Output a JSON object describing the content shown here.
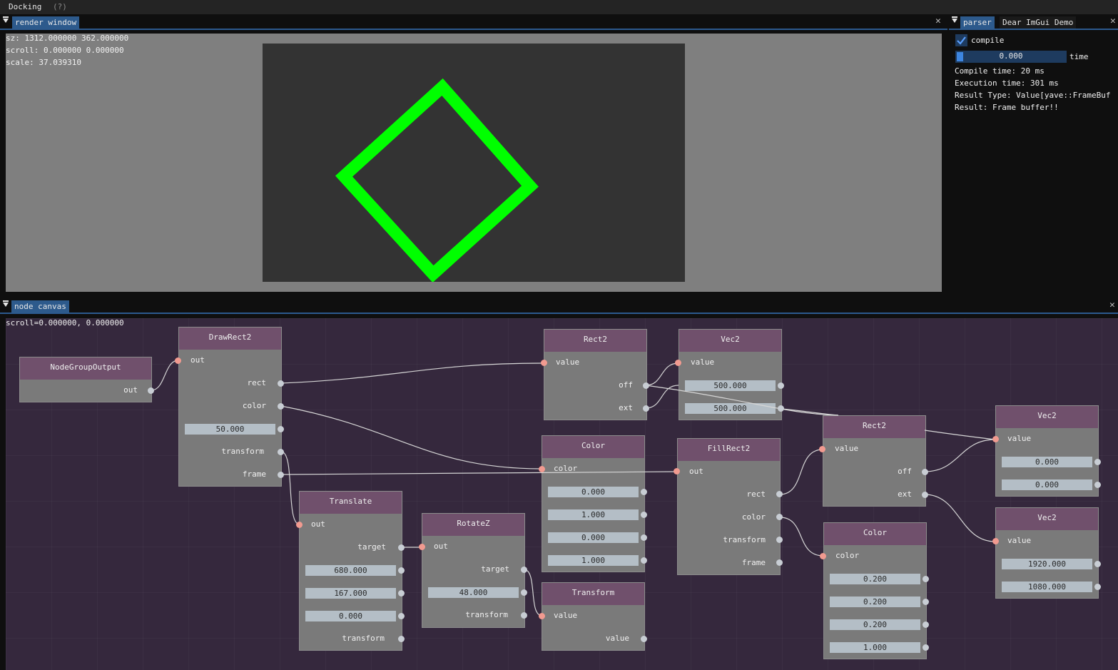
{
  "menubar": {
    "docking": "Docking",
    "help": "(?)"
  },
  "render_window": {
    "tab": "render window",
    "info_sz": "sz: 1312.000000 362.000000",
    "info_scroll": "scroll: 0.000000 0.000000",
    "info_scale": "scale: 37.039310",
    "shape_color": "#00ff00"
  },
  "parser": {
    "tab": "parser",
    "tab2": "Dear ImGui Demo",
    "compile_label": "compile",
    "compile_checked": true,
    "time_value": "0.000",
    "time_label": "time",
    "compile_time": "Compile time: 20 ms",
    "execution_time": "Execution time: 301 ms",
    "result_type": "Result Type: Value[yave::FrameBuf",
    "result": "Result: Frame buffer!!"
  },
  "node_canvas": {
    "tab": "node canvas",
    "scroll": "scroll=0.000000, 0.000000",
    "nodes": {
      "nodegroupoutput": {
        "title": "NodeGroupOutput",
        "out": "out"
      },
      "drawrect2": {
        "title": "DrawRect2",
        "out": "out",
        "rect": "rect",
        "color": "color",
        "value": "50.000",
        "transform": "transform",
        "frame": "frame"
      },
      "translate": {
        "title": "Translate",
        "out": "out",
        "target": "target",
        "v1": "680.000",
        "v2": "167.000",
        "v3": "0.000",
        "transform": "transform"
      },
      "rotatez": {
        "title": "RotateZ",
        "out": "out",
        "target": "target",
        "v1": "48.000",
        "transform": "transform"
      },
      "rect2_a": {
        "title": "Rect2",
        "value": "value",
        "off": "off",
        "ext": "ext"
      },
      "vec2_a": {
        "title": "Vec2",
        "value": "value",
        "v1": "500.000",
        "v2": "500.000"
      },
      "color_a": {
        "title": "Color",
        "color": "color",
        "v1": "0.000",
        "v2": "1.000",
        "v3": "0.000",
        "v4": "1.000"
      },
      "transform": {
        "title": "Transform",
        "value_in": "value",
        "value_out": "value"
      },
      "fillrect2": {
        "title": "FillRect2",
        "out": "out",
        "rect": "rect",
        "color": "color",
        "transform": "transform",
        "frame": "frame"
      },
      "rect2_b": {
        "title": "Rect2",
        "value": "value",
        "off": "off",
        "ext": "ext"
      },
      "color_b": {
        "title": "Color",
        "color": "color",
        "v1": "0.200",
        "v2": "0.200",
        "v3": "0.200",
        "v4": "1.000"
      },
      "vec2_b": {
        "title": "Vec2",
        "value": "value",
        "v1": "0.000",
        "v2": "0.000"
      },
      "vec2_c": {
        "title": "Vec2",
        "value": "value",
        "v1": "1920.000",
        "v2": "1080.000"
      }
    }
  }
}
